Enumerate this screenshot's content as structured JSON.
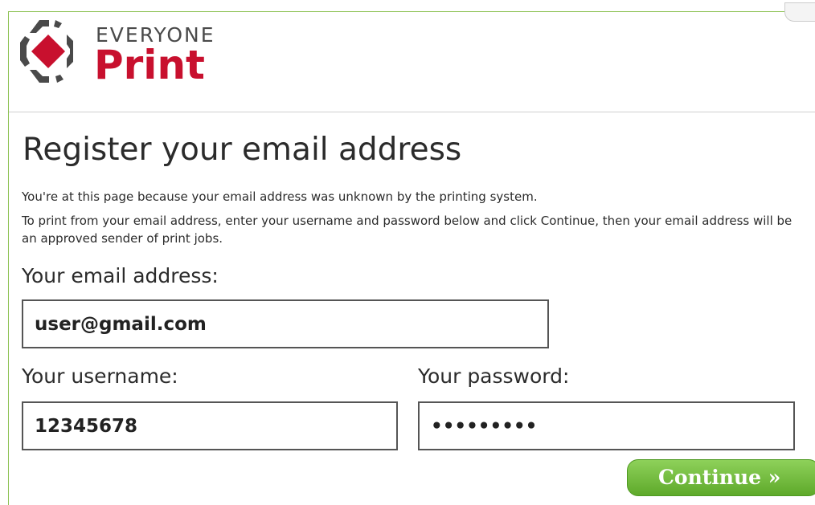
{
  "brand": {
    "name_top": "EVERYONE",
    "name_bottom": "Print",
    "colors": {
      "red": "#c8102e",
      "dark": "#4a4a4a",
      "green": "#6cbf3a"
    }
  },
  "page": {
    "title": "Register your email address",
    "info_line_1": "You're at this page because your email address was unknown by the printing system.",
    "info_line_2": "To print from your email address, enter your username and password below and click Continue, then your email address will be an approved sender of print jobs."
  },
  "form": {
    "email_label": "Your email address:",
    "email_value": "user@gmail.com",
    "username_label": "Your username:",
    "username_value": "12345678",
    "password_label": "Your password:",
    "password_value": "•••••••••",
    "continue_label": "Continue »"
  }
}
